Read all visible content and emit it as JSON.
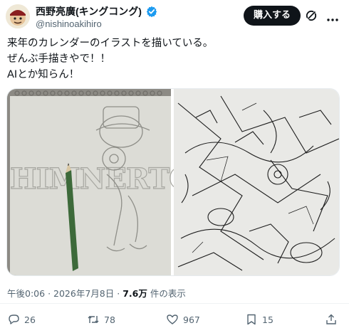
{
  "author": {
    "display_name": "西野亮廣(キングコング)",
    "handle": "@nishinoakihiro"
  },
  "header": {
    "buy_label": "購入する",
    "icons": [
      "grok-icon",
      "more-icon"
    ]
  },
  "tweet": {
    "lines": [
      "来年のカレンダーのイラストを描いている。",
      "ぜんぶ手描きやで！！",
      "AIとか知らん！"
    ]
  },
  "media": {
    "left_sketch_lettering": "HIMNERTOW"
  },
  "meta": {
    "time": "午後0:06",
    "separator": "·",
    "date": "2026年7月8日",
    "views": "7.6万",
    "views_suffix": "件の表示"
  },
  "actions": {
    "replies": "26",
    "reposts": "78",
    "likes": "967",
    "bookmarks": "15"
  },
  "colors": {
    "text": "#0f1419",
    "secondary": "#536471",
    "verified": "#1d9bf0"
  }
}
